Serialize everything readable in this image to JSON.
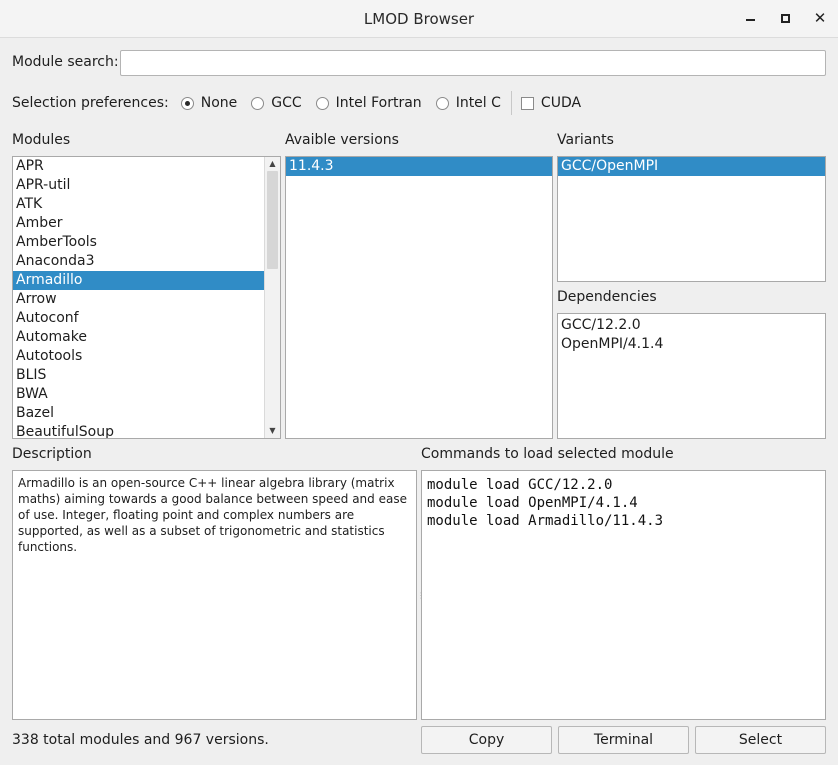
{
  "window": {
    "title": "LMOD Browser"
  },
  "search": {
    "label": "Module search:",
    "value": "",
    "placeholder": ""
  },
  "preferences": {
    "label": "Selection preferences:",
    "options": [
      "None",
      "GCC",
      "Intel Fortran",
      "Intel C"
    ],
    "selected": "None",
    "cuda_label": "CUDA",
    "cuda_checked": false
  },
  "modules": {
    "label": "Modules",
    "items": [
      "APR",
      "APR-util",
      "ATK",
      "Amber",
      "AmberTools",
      "Anaconda3",
      "Armadillo",
      "Arrow",
      "Autoconf",
      "Automake",
      "Autotools",
      "BLIS",
      "BWA",
      "Bazel",
      "BeautifulSoup"
    ],
    "selected": "Armadillo"
  },
  "versions": {
    "label": "Avaible versions",
    "items": [
      "11.4.3"
    ],
    "selected": "11.4.3"
  },
  "variants": {
    "label": "Variants",
    "items": [
      "GCC/OpenMPI"
    ],
    "selected": "GCC/OpenMPI"
  },
  "dependencies": {
    "label": "Dependencies",
    "items": [
      "GCC/12.2.0",
      "OpenMPI/4.1.4"
    ]
  },
  "description": {
    "label": "Description",
    "text": "Armadillo is an open-source C++ linear algebra library (matrix maths) aiming towards a good balance between speed and ease of use. Integer, floating point and complex numbers are supported, as well as a subset of trigonometric and statistics functions."
  },
  "commands": {
    "label": "Commands to load selected module",
    "lines": [
      "module load GCC/12.2.0",
      "module load OpenMPI/4.1.4",
      "module load Armadillo/11.4.3"
    ]
  },
  "status": "338 total modules and 967 versions.",
  "buttons": {
    "copy": "Copy",
    "terminal": "Terminal",
    "select": "Select"
  },
  "colors": {
    "selection": "#308cc6",
    "background": "#efefef"
  }
}
